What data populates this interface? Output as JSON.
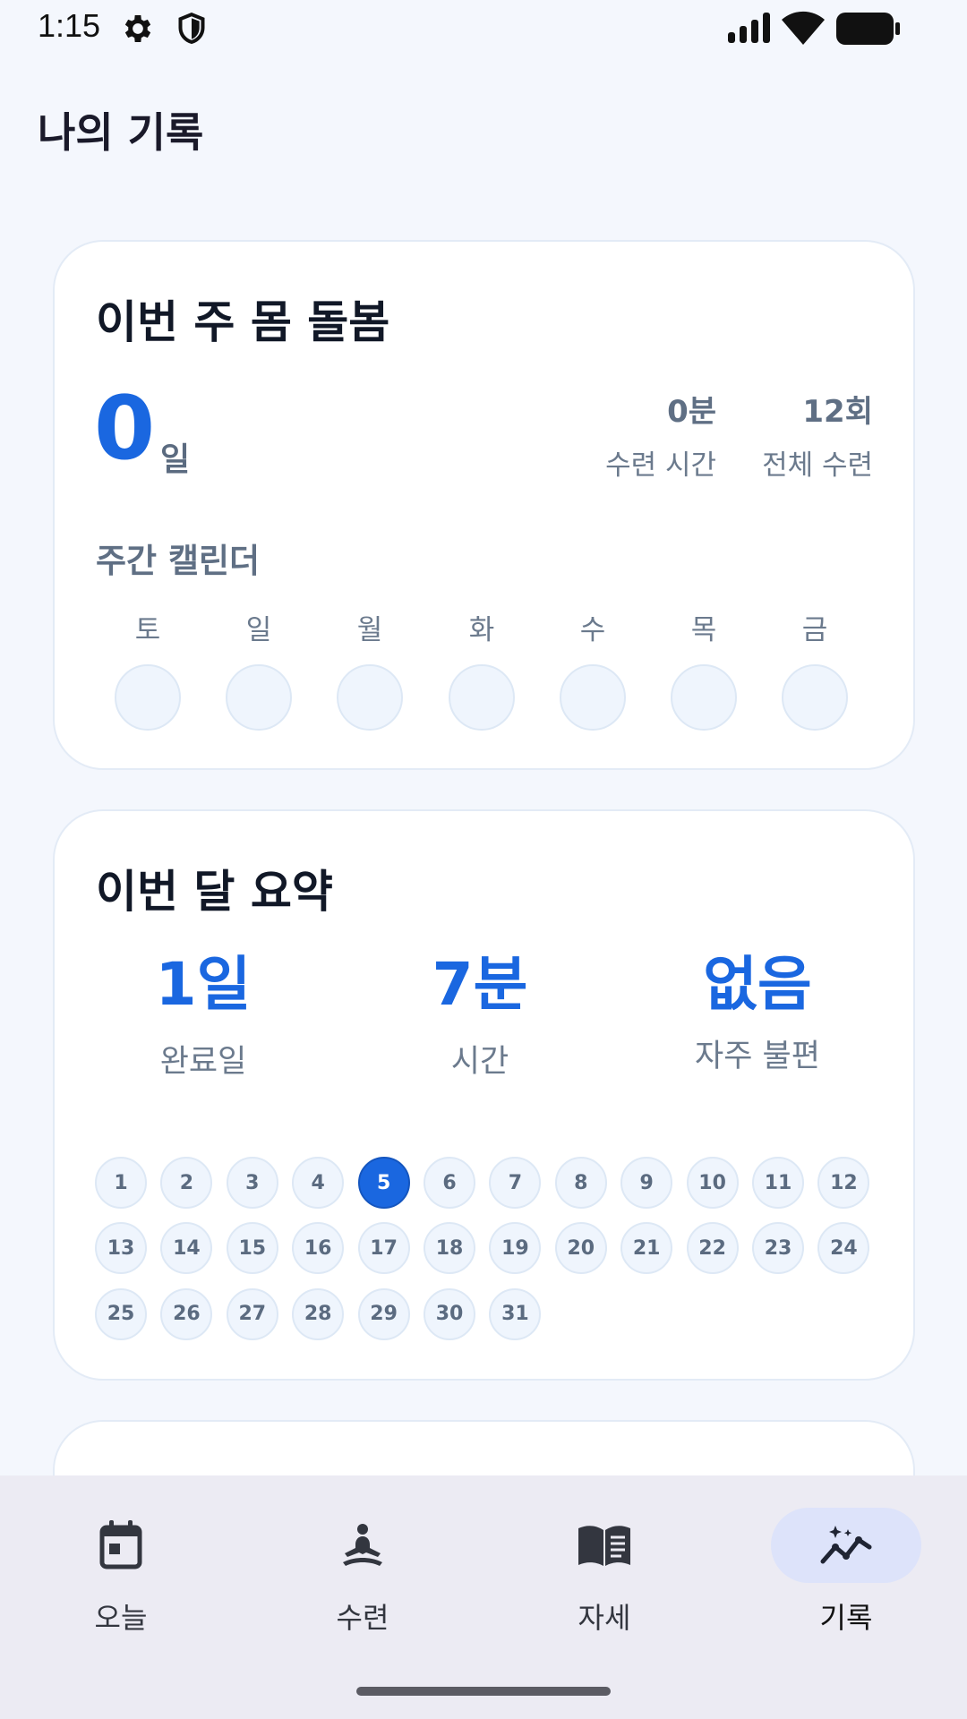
{
  "status_bar": {
    "time": "1:15",
    "icons": [
      "gear-icon",
      "shield-icon",
      "signal-icon",
      "wifi-icon",
      "battery-icon"
    ]
  },
  "page": {
    "title": "나의 기록"
  },
  "weekly_card": {
    "title": "이번 주 몸 돌봄",
    "streak_value": "0",
    "streak_unit": "일",
    "stats": [
      {
        "value": "0분",
        "label": "수련 시간"
      },
      {
        "value": "12회",
        "label": "전체 수련"
      }
    ],
    "calendar_label": "주간 캘린더",
    "days": [
      "토",
      "일",
      "월",
      "화",
      "수",
      "목",
      "금"
    ]
  },
  "monthly_card": {
    "title": "이번 달 요약",
    "summary": [
      {
        "value": "1일",
        "label": "완료일"
      },
      {
        "value": "7분",
        "label": "시간"
      },
      {
        "value": "없음",
        "label": "자주 불편"
      }
    ],
    "dates": [
      "1",
      "2",
      "3",
      "4",
      "5",
      "6",
      "7",
      "8",
      "9",
      "10",
      "11",
      "12",
      "13",
      "14",
      "15",
      "16",
      "17",
      "18",
      "19",
      "20",
      "21",
      "22",
      "23",
      "24",
      "25",
      "26",
      "27",
      "28",
      "29",
      "30",
      "31"
    ],
    "active_date": "5"
  },
  "nav": {
    "items": [
      {
        "label": "오늘",
        "icon": "calendar-icon"
      },
      {
        "label": "수련",
        "icon": "meditation-icon"
      },
      {
        "label": "자세",
        "icon": "book-icon"
      },
      {
        "label": "기록",
        "icon": "chart-icon"
      }
    ],
    "active": "기록"
  },
  "colors": {
    "accent": "#1a67e0",
    "background": "#f4f7fd",
    "nav_background": "#ecebf3",
    "nav_active_pill": "#dde3fa"
  }
}
